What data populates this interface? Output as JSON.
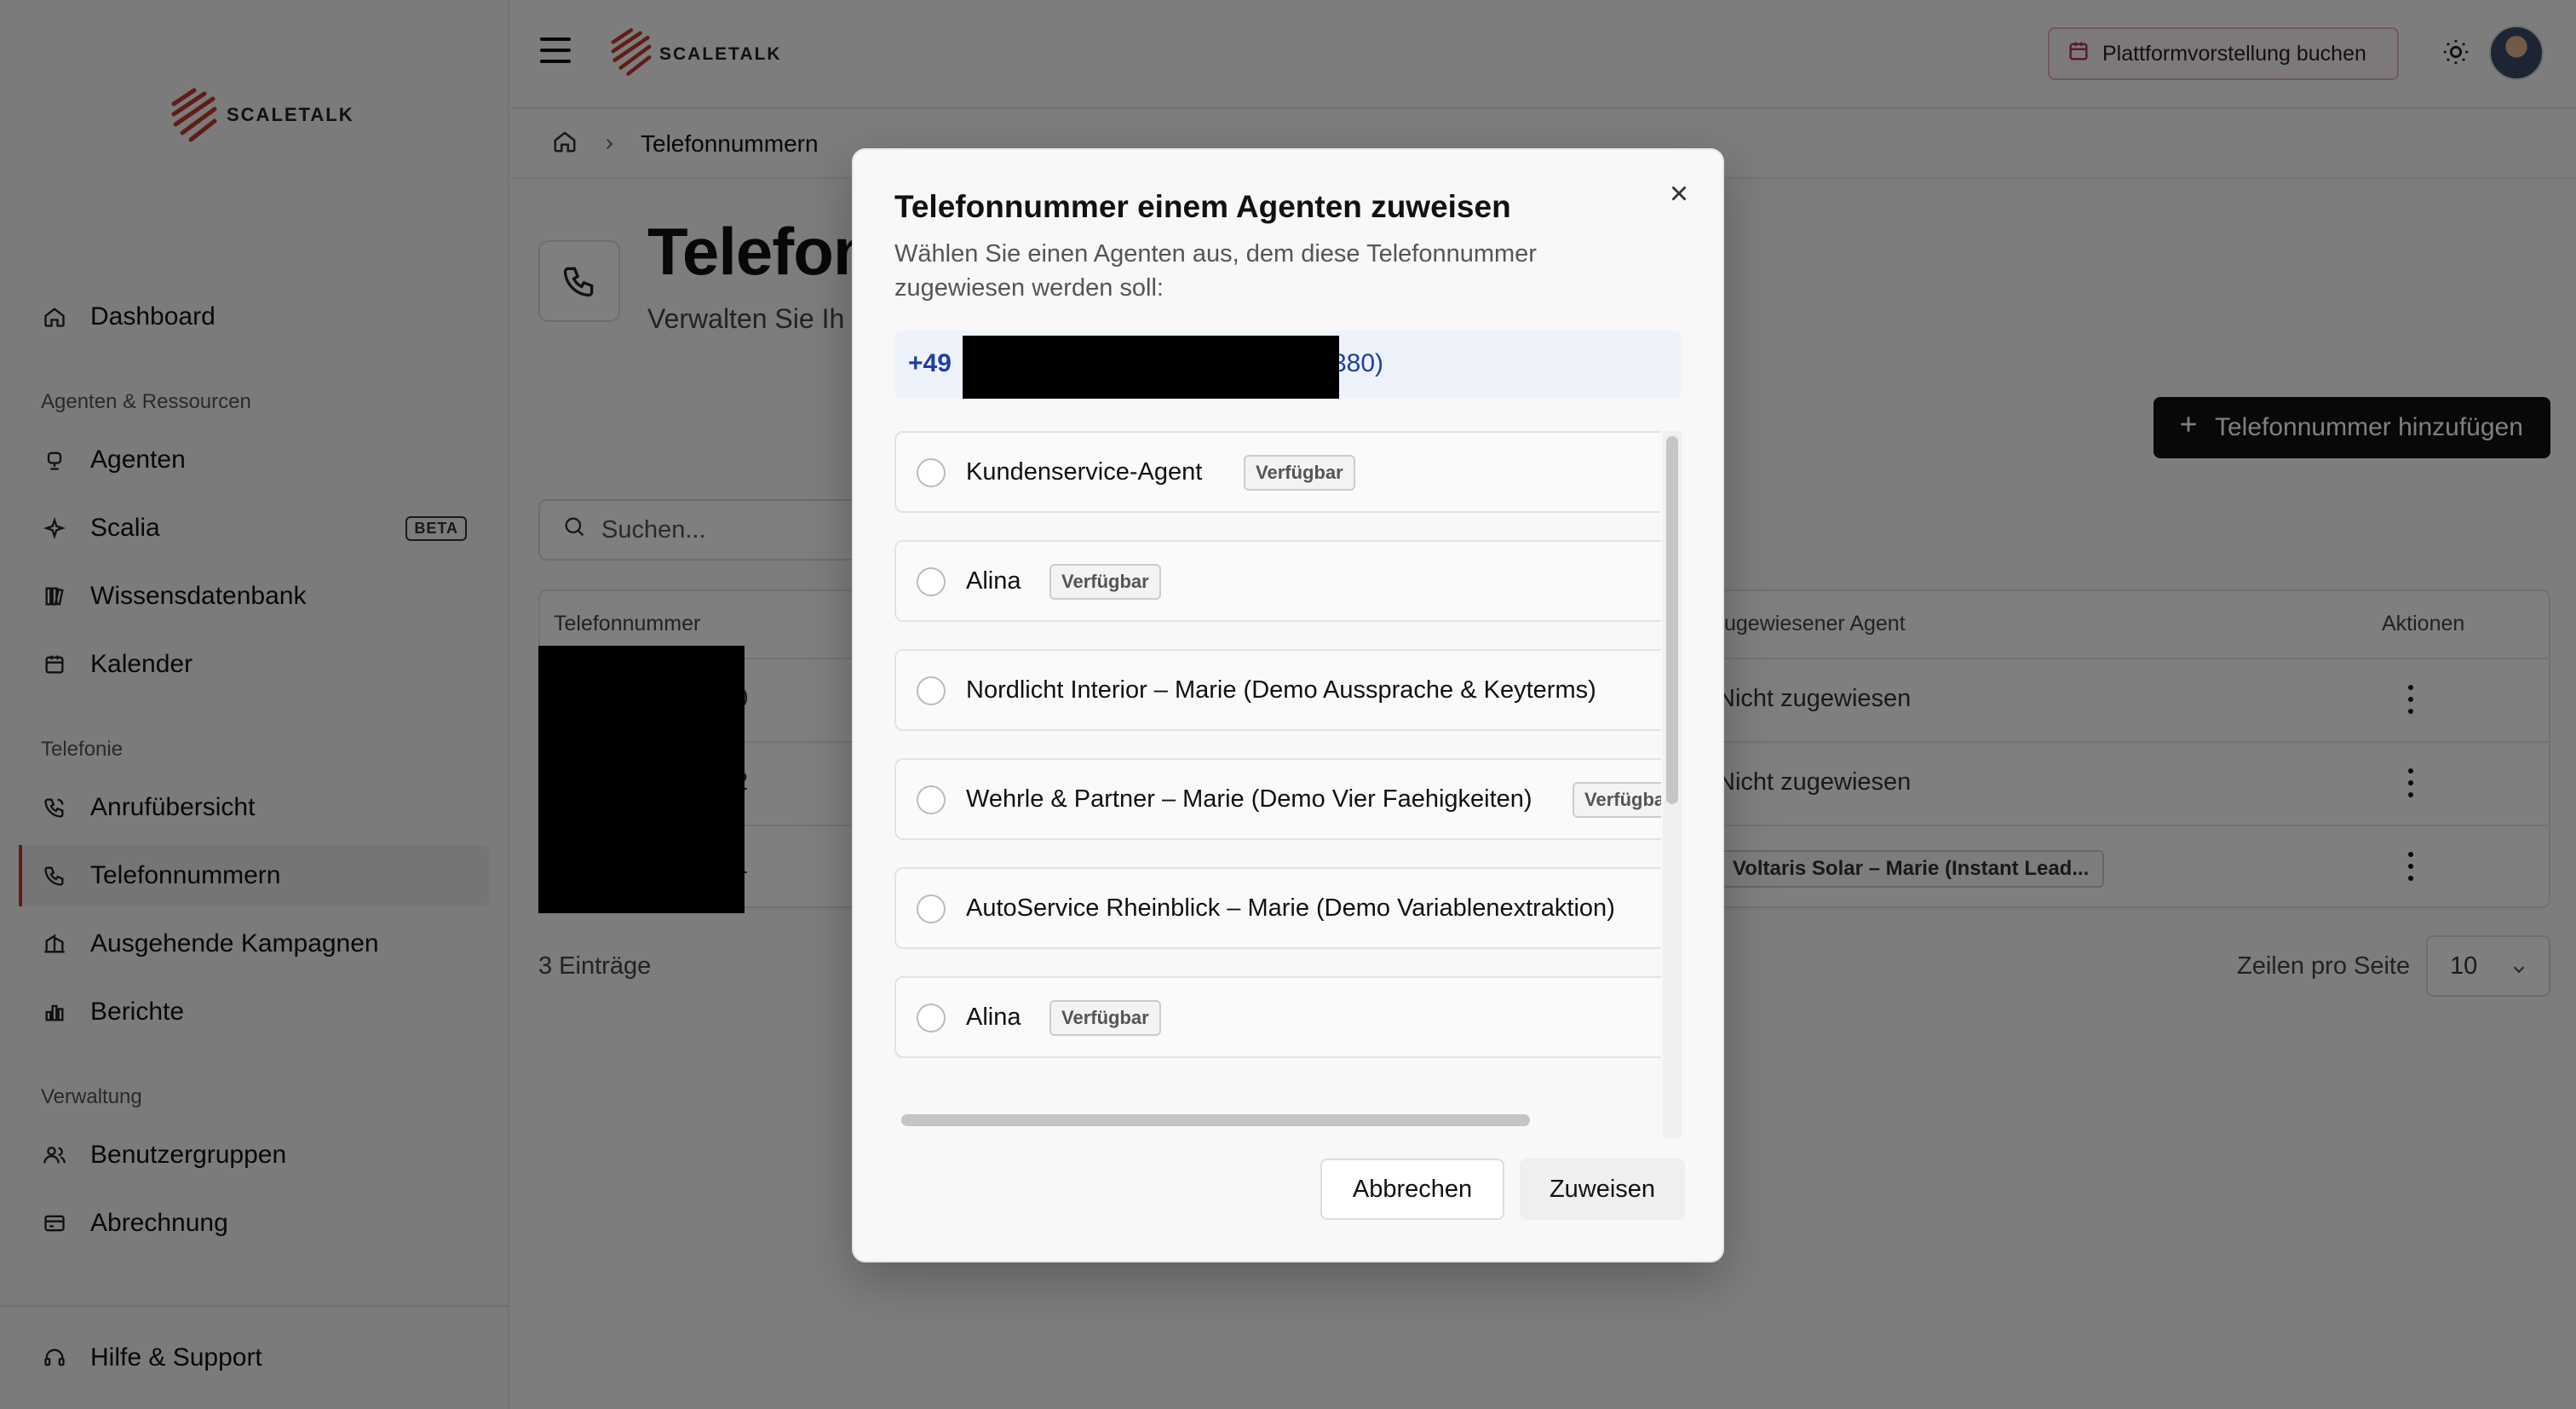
{
  "brand": {
    "name": "SCALETALK"
  },
  "sidebar": {
    "items": [
      {
        "label": "Dashboard"
      },
      {
        "label": "Agenten"
      },
      {
        "label": "Scalia",
        "badge": "BETA"
      },
      {
        "label": "Wissensdatenbank"
      },
      {
        "label": "Kalender"
      },
      {
        "label": "Anrufübersicht"
      },
      {
        "label": "Telefonnummern"
      },
      {
        "label": "Ausgehende Kampagnen"
      },
      {
        "label": "Berichte"
      },
      {
        "label": "Benutzergruppen"
      },
      {
        "label": "Abrechnung"
      },
      {
        "label": "Hilfe & Support"
      }
    ],
    "sections": [
      "Agenten & Ressourcen",
      "Telefonie",
      "Verwaltung"
    ]
  },
  "topbar": {
    "demo_button": "Plattformvorstellung buchen"
  },
  "breadcrumb": {
    "current": "Telefonnummern"
  },
  "page": {
    "title": "Telefon",
    "subtitle": "Verwalten Sie Ih",
    "add_button": "Telefonnummer hinzufügen",
    "search_placeholder": "Suchen...",
    "entries": "3 Einträge",
    "rows_per_page_label": "Zeilen pro Seite",
    "rows_per_page_value": "10"
  },
  "table": {
    "headers": {
      "phone": "Telefonnummer",
      "agent": "ugewiesener Agent",
      "actions": "Aktionen"
    },
    "rows": [
      {
        "phone_tail": "0",
        "agent": "Nicht zugewiesen"
      },
      {
        "phone_tail": "2",
        "agent": "Nicht zugewiesen"
      },
      {
        "phone_tail": "1",
        "agent_chip": "Voltaris Solar – Marie (Instant Lead..."
      }
    ]
  },
  "modal": {
    "title": "Telefonnummer einem Agenten zuweisen",
    "description": "Wählen Sie einen Agenten aus, dem diese Telefonnummer zugewiesen werden soll:",
    "phone_prefix": "+49",
    "phone_suffix": "380)",
    "agents": [
      {
        "name": "Kundenservice-Agent",
        "badge": "Verfügbar"
      },
      {
        "name": "Alina",
        "badge": "Verfügbar"
      },
      {
        "name": "Nordlicht Interior – Marie (Demo Aussprache & Keyterms)",
        "badge": ""
      },
      {
        "name": "Wehrle & Partner – Marie (Demo Vier Faehigkeiten)",
        "badge": "Verfügba"
      },
      {
        "name": "AutoService Rheinblick – Marie (Demo Variablenextraktion)",
        "badge": ""
      },
      {
        "name": "Alina",
        "badge": "Verfügbar"
      }
    ],
    "cancel": "Abbrechen",
    "assign": "Zuweisen"
  },
  "colors": {
    "accent": "#c0392b",
    "primary_button": "#111111",
    "phone_text": "#1f3fa3"
  }
}
